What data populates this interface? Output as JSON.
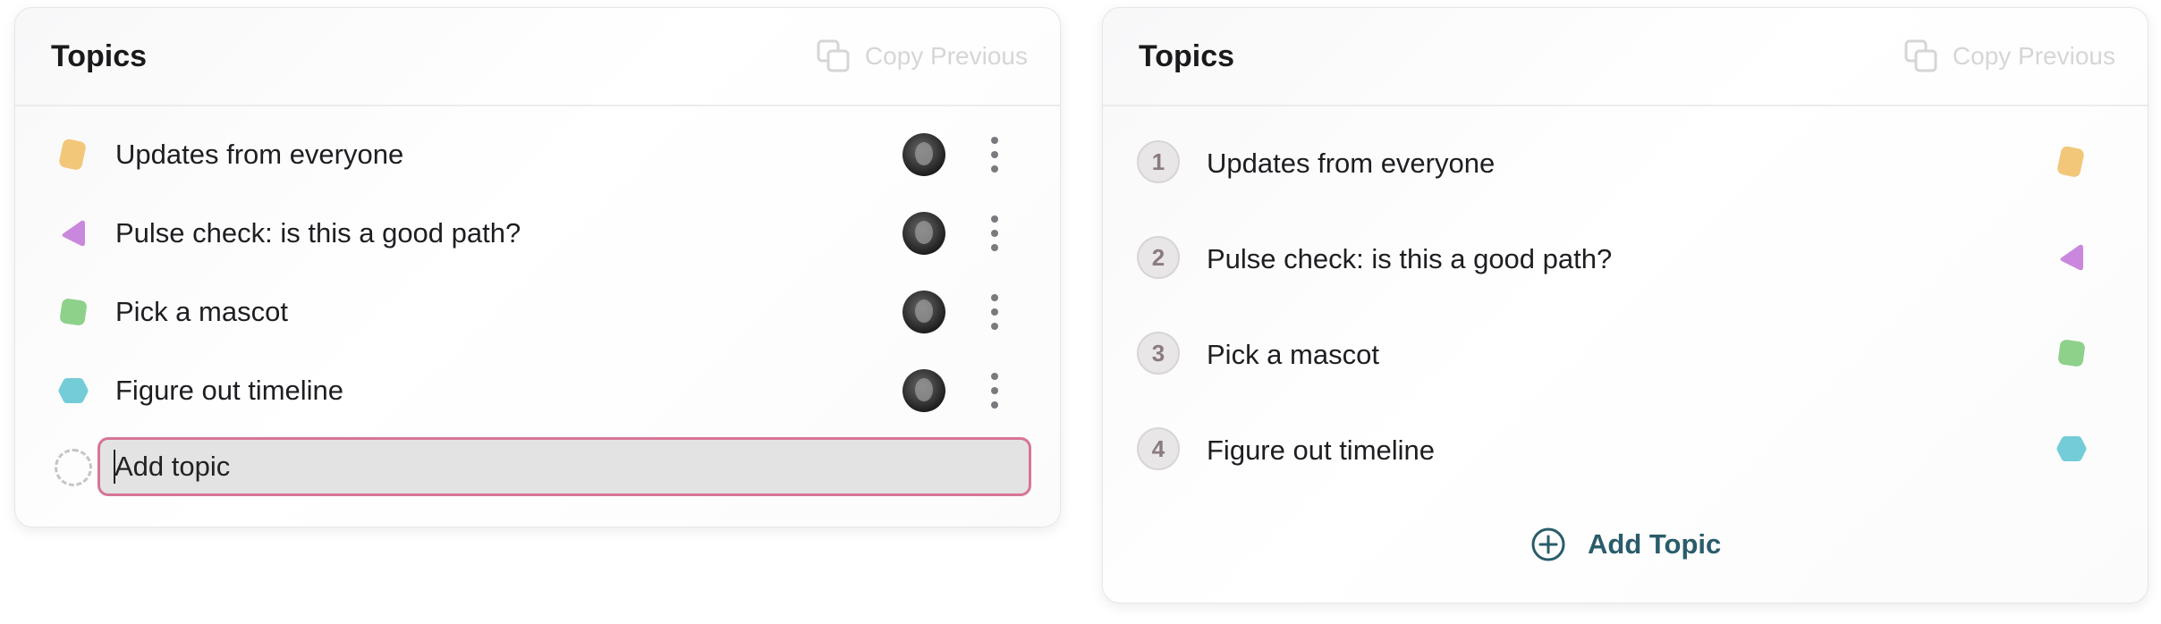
{
  "left_panel": {
    "title": "Topics",
    "copy_previous": "Copy Previous",
    "topics": [
      {
        "label": "Updates from everyone",
        "icon": "orange-rounded-square-icon",
        "color": "#F2C77A"
      },
      {
        "label": "Pulse check: is this a good path?",
        "icon": "purple-triangle-icon",
        "color": "#C988DD"
      },
      {
        "label": "Pick a mascot",
        "icon": "green-rounded-square-icon",
        "color": "#8ED18A"
      },
      {
        "label": "Figure out timeline",
        "icon": "teal-hexagon-icon",
        "color": "#74CCD8"
      }
    ],
    "add_input": {
      "value": "Add topic",
      "placeholder": "Add topic"
    }
  },
  "right_panel": {
    "title": "Topics",
    "copy_previous": "Copy Previous",
    "topics": [
      {
        "number": "1",
        "label": "Updates from everyone",
        "icon": "orange-rounded-square-icon",
        "color": "#F2C77A"
      },
      {
        "number": "2",
        "label": "Pulse check: is this a good path?",
        "icon": "purple-triangle-icon",
        "color": "#C988DD"
      },
      {
        "number": "3",
        "label": "Pick a mascot",
        "icon": "green-rounded-square-icon",
        "color": "#8ED18A"
      },
      {
        "number": "4",
        "label": "Figure out timeline",
        "icon": "teal-hexagon-icon",
        "color": "#74CCD8"
      }
    ],
    "add_button": "Add Topic"
  },
  "colors": {
    "accent": "#2A5C6B",
    "input_border": "#D77595"
  }
}
